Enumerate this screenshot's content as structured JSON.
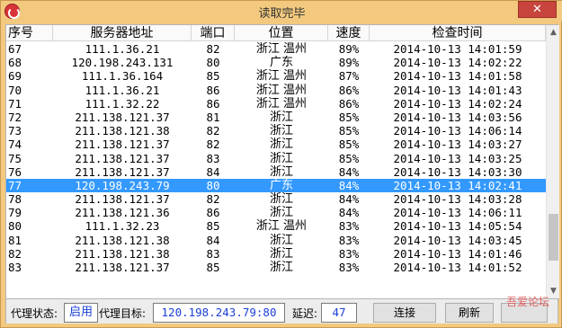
{
  "window": {
    "title": "读取完毕",
    "close_label": "✕"
  },
  "table": {
    "columns": [
      "序号",
      "服务器地址",
      "端口",
      "位置",
      "速度",
      "检查时间"
    ],
    "rows": [
      [
        "67",
        "111.1.36.21",
        "82",
        "浙江 温州",
        "89%",
        "2014-10-13 14:01:59"
      ],
      [
        "68",
        "120.198.243.131",
        "80",
        "广东",
        "89%",
        "2014-10-13 14:02:22"
      ],
      [
        "69",
        "111.1.36.164",
        "85",
        "浙江 温州",
        "87%",
        "2014-10-13 14:01:58"
      ],
      [
        "70",
        "111.1.36.21",
        "86",
        "浙江 温州",
        "86%",
        "2014-10-13 14:01:43"
      ],
      [
        "71",
        "111.1.32.22",
        "86",
        "浙江 温州",
        "86%",
        "2014-10-13 14:02:24"
      ],
      [
        "72",
        "211.138.121.37",
        "81",
        "浙江",
        "85%",
        "2014-10-13 14:03:56"
      ],
      [
        "73",
        "211.138.121.38",
        "82",
        "浙江",
        "85%",
        "2014-10-13 14:06:14"
      ],
      [
        "74",
        "211.138.121.37",
        "82",
        "浙江",
        "85%",
        "2014-10-13 14:03:27"
      ],
      [
        "75",
        "211.138.121.37",
        "83",
        "浙江",
        "85%",
        "2014-10-13 14:03:25"
      ],
      [
        "76",
        "211.138.121.37",
        "84",
        "浙江",
        "84%",
        "2014-10-13 14:03:30"
      ],
      [
        "77",
        "120.198.243.79",
        "80",
        "广东",
        "84%",
        "2014-10-13 14:02:41"
      ],
      [
        "78",
        "211.138.121.37",
        "82",
        "浙江",
        "84%",
        "2014-10-13 14:03:28"
      ],
      [
        "79",
        "211.138.121.36",
        "86",
        "浙江",
        "84%",
        "2014-10-13 14:06:11"
      ],
      [
        "80",
        "111.1.32.23",
        "85",
        "浙江 温州",
        "83%",
        "2014-10-13 14:05:54"
      ],
      [
        "81",
        "211.138.121.38",
        "84",
        "浙江",
        "83%",
        "2014-10-13 14:03:45"
      ],
      [
        "82",
        "211.138.121.38",
        "83",
        "浙江",
        "83%",
        "2014-10-13 14:01:46"
      ],
      [
        "83",
        "211.138.121.37",
        "85",
        "浙江",
        "83%",
        "2014-10-13 14:01:52"
      ]
    ],
    "selected_index": 10
  },
  "status": {
    "proxy_state_label": "代理状态:",
    "proxy_state_value": "启用",
    "proxy_target_label": "代理目标:",
    "proxy_target_value": "120.198.243.79:80",
    "latency_label": "延迟:",
    "latency_value": "47",
    "connect_label": "连接",
    "refresh_label": "刷新",
    "third_button_label": "",
    "watermark_text": "吾爱论坛"
  }
}
